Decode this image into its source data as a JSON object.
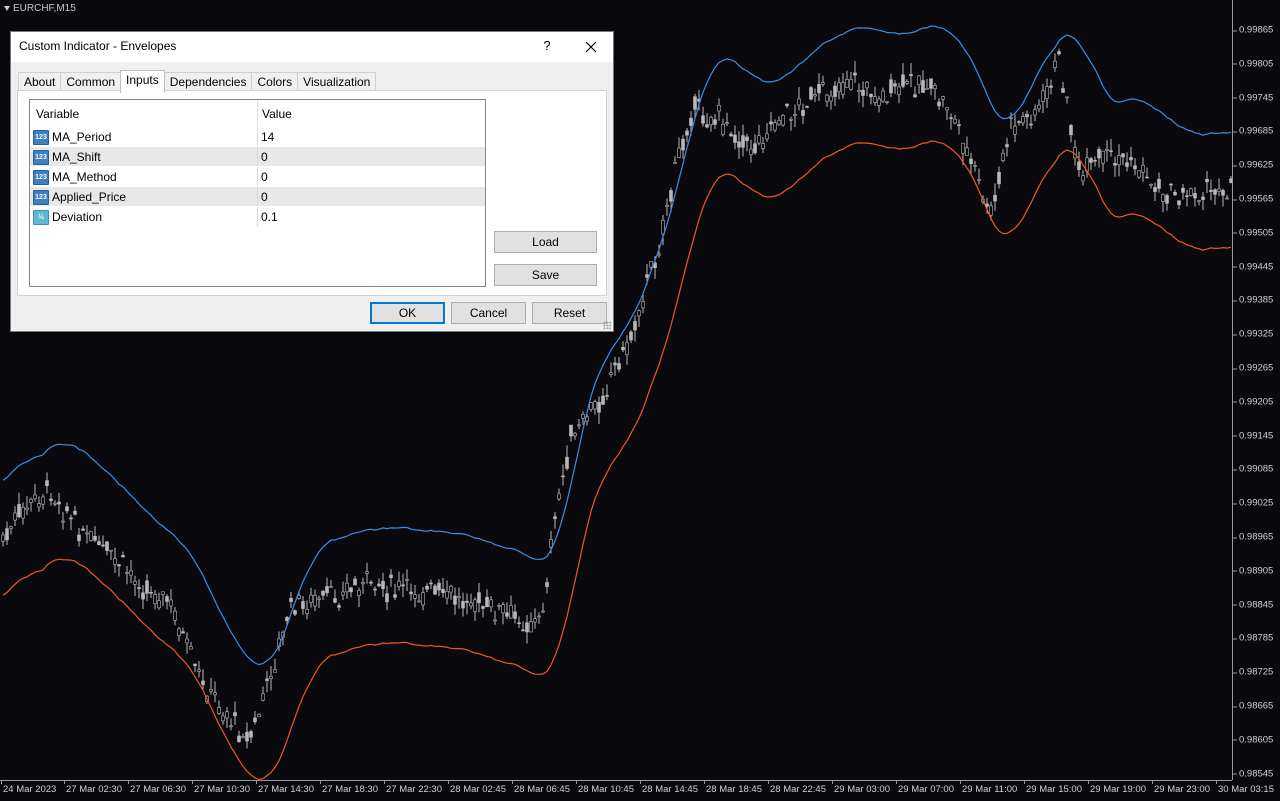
{
  "chart": {
    "symbol": "EURCHF,M15",
    "price_ticks": [
      "0.99865",
      "0.99805",
      "0.99745",
      "0.99685",
      "0.99625",
      "0.99565",
      "0.99505",
      "0.99445",
      "0.99385",
      "0.99325",
      "0.99265",
      "0.99205",
      "0.99145",
      "0.99085",
      "0.99025",
      "0.98965",
      "0.98905",
      "0.98845",
      "0.98785",
      "0.98725",
      "0.98665",
      "0.98605",
      "0.98545"
    ],
    "time_ticks": [
      "24 Mar 2023",
      "27 Mar 02:30",
      "27 Mar 06:30",
      "27 Mar 10:30",
      "27 Mar 14:30",
      "27 Mar 18:30",
      "27 Mar 22:30",
      "28 Mar 02:45",
      "28 Mar 06:45",
      "28 Mar 10:45",
      "28 Mar 14:45",
      "28 Mar 18:45",
      "28 Mar 22:45",
      "29 Mar 03:00",
      "29 Mar 07:00",
      "29 Mar 11:00",
      "29 Mar 15:00",
      "29 Mar 19:00",
      "29 Mar 23:00",
      "30 Mar 03:15"
    ],
    "colors": {
      "upper_band": "#3a8ee6",
      "lower_band": "#f0552a",
      "candles": "#b8b8b8",
      "background": "#0a0a0e"
    }
  },
  "dialog": {
    "title": "Custom Indicator - Envelopes",
    "help": "?",
    "tabs": [
      "About",
      "Common",
      "Inputs",
      "Dependencies",
      "Colors",
      "Visualization"
    ],
    "active_tab": "Inputs",
    "grid": {
      "headers": {
        "variable": "Variable",
        "value": "Value"
      },
      "rows": [
        {
          "icon": "int-icon",
          "variable": "MA_Period",
          "value": "14"
        },
        {
          "icon": "int-icon",
          "variable": "MA_Shift",
          "value": "0"
        },
        {
          "icon": "int-icon",
          "variable": "MA_Method",
          "value": "0"
        },
        {
          "icon": "int-icon",
          "variable": "Applied_Price",
          "value": "0"
        },
        {
          "icon": "double-icon",
          "variable": "Deviation",
          "value": "0.1"
        }
      ]
    },
    "buttons": {
      "load": "Load",
      "save": "Save",
      "ok": "OK",
      "cancel": "Cancel",
      "reset": "Reset"
    }
  }
}
